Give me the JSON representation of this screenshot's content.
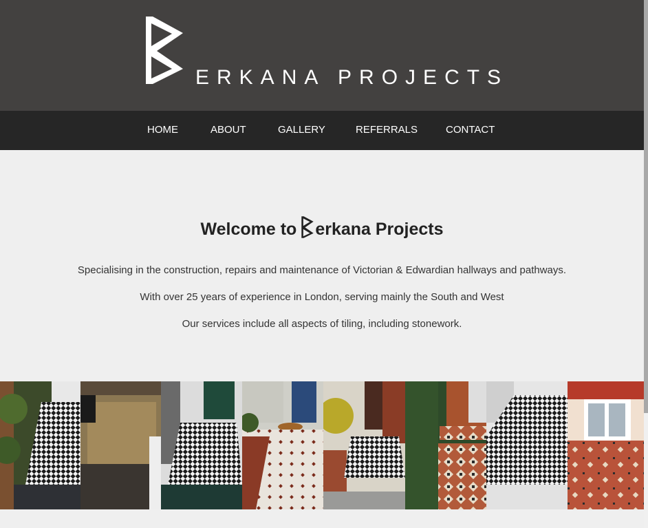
{
  "brand": {
    "logo_letter": "B",
    "wordmark": "ERKANA PROJECTS",
    "header_bg": "#434140",
    "nav_bg": "#262626"
  },
  "nav": {
    "items": [
      {
        "label": "HOME"
      },
      {
        "label": "ABOUT"
      },
      {
        "label": "GALLERY"
      },
      {
        "label": "REFERRALS"
      },
      {
        "label": "CONTACT"
      }
    ]
  },
  "main": {
    "welcome_prefix": "Welcome to",
    "welcome_brand_rest": "erkana Projects",
    "paragraphs": [
      "Specialising in the construction, repairs and maintenance of Victorian & Edwardian hallways and pathways.",
      "With over 25 years of experience in London, serving mainly the South and West",
      "Our services include all aspects of tiling, including stonework."
    ]
  },
  "gallery": {
    "images": [
      {
        "name": "black-white-path-with-plants"
      },
      {
        "name": "stone-steps-basement"
      },
      {
        "name": "green-door-checker-path"
      },
      {
        "name": "blue-door-cat-path"
      },
      {
        "name": "brick-wall-path-steps"
      },
      {
        "name": "hedge-geometric-path"
      },
      {
        "name": "checker-path-long"
      },
      {
        "name": "red-terracotta-patio"
      }
    ]
  }
}
